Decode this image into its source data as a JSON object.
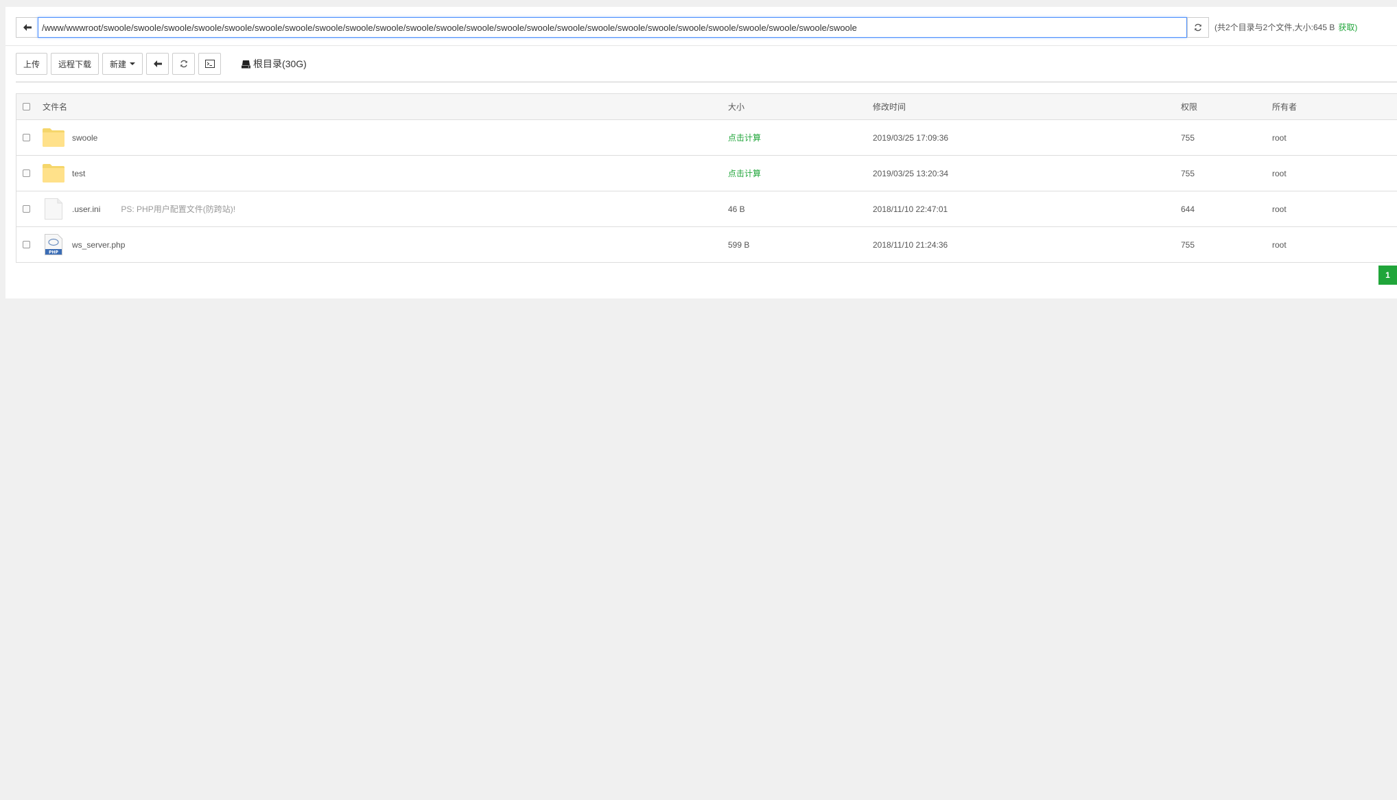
{
  "path_bar": {
    "path": "/www/wwwroot/swoole/swoole/swoole/swoole/swoole/swoole/swoole/swoole/swoole/swoole/swoole/swoole/swoole/swoole/swoole/swoole/swoole/swoole/swoole/swoole/swoole/swoole/swoole/swoole/swoole",
    "summary": "(共2个目录与2个文件,大小:645 B",
    "fetch_label": "获取)"
  },
  "toolbar": {
    "upload_label": "上传",
    "remote_download_label": "远程下载",
    "new_label": "新建",
    "disk_label": "根目录(30G)"
  },
  "table": {
    "headers": {
      "name": "文件名",
      "size": "大小",
      "time": "修改时间",
      "perm": "权限",
      "owner": "所有者"
    },
    "rows": [
      {
        "name": "swoole",
        "type": "folder",
        "size": "点击计算",
        "time": "2019/03/25 17:09:36",
        "perm": "755",
        "owner": "root"
      },
      {
        "name": "test",
        "type": "folder",
        "size": "点击计算",
        "time": "2019/03/25 13:20:34",
        "perm": "755",
        "owner": "root"
      },
      {
        "name": ".user.ini",
        "type": "file",
        "note": "PS: PHP用户配置文件(防跨站)!",
        "size": "46 B",
        "time": "2018/11/10 22:47:01",
        "perm": "644",
        "owner": "root"
      },
      {
        "name": "ws_server.php",
        "type": "php",
        "size": "599 B",
        "time": "2018/11/10 21:24:36",
        "perm": "755",
        "owner": "root"
      }
    ]
  },
  "pagination": {
    "current_page": "1"
  },
  "colors": {
    "accent": "#20a53a",
    "folder": "#ffe18a",
    "input_focus": "#4d90fe"
  }
}
